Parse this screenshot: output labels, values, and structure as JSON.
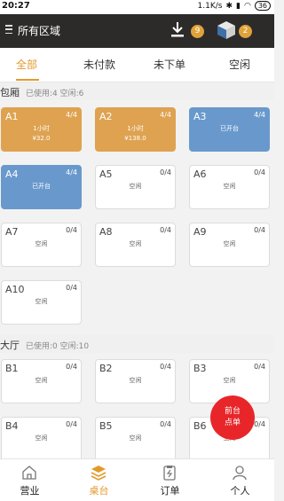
{
  "status_bar": {
    "time": "20:27",
    "speed": "1.1K/s",
    "battery": "36"
  },
  "header": {
    "title": "所有区域",
    "download_badge": "9",
    "box_badge": "2",
    "colors": {
      "background": "#2c2b2a",
      "badge": "#e0a33a"
    }
  },
  "tabs": [
    {
      "label": "全部",
      "active": true
    },
    {
      "label": "未付款",
      "active": false
    },
    {
      "label": "未下单",
      "active": false
    },
    {
      "label": "空闲",
      "active": false
    }
  ],
  "sections": [
    {
      "name": "包厢",
      "stats": "已使用:4 空闲:6",
      "tables": [
        {
          "name": "A1",
          "capacity": "4/4",
          "status": "1小时",
          "amount": "¥32.0",
          "color": "orange"
        },
        {
          "name": "A2",
          "capacity": "4/4",
          "status": "1小时",
          "amount": "¥138.0",
          "color": "orange"
        },
        {
          "name": "A3",
          "capacity": "4/4",
          "status": "已开台",
          "amount": "",
          "color": "blue"
        },
        {
          "name": "A4",
          "capacity": "4/4",
          "status": "已开台",
          "amount": "",
          "color": "blue"
        },
        {
          "name": "A5",
          "capacity": "0/4",
          "status": "空闲",
          "amount": "",
          "color": "white"
        },
        {
          "name": "A6",
          "capacity": "0/4",
          "status": "空闲",
          "amount": "",
          "color": "white"
        },
        {
          "name": "A7",
          "capacity": "0/4",
          "status": "空闲",
          "amount": "",
          "color": "white"
        },
        {
          "name": "A8",
          "capacity": "0/4",
          "status": "空闲",
          "amount": "",
          "color": "white"
        },
        {
          "name": "A9",
          "capacity": "0/4",
          "status": "空闲",
          "amount": "",
          "color": "white"
        },
        {
          "name": "A10",
          "capacity": "0/4",
          "status": "空闲",
          "amount": "",
          "color": "white"
        }
      ]
    },
    {
      "name": "大厅",
      "stats": "已使用:0 空闲:10",
      "tables": [
        {
          "name": "B1",
          "capacity": "0/4",
          "status": "空闲",
          "amount": "",
          "color": "white"
        },
        {
          "name": "B2",
          "capacity": "0/4",
          "status": "空闲",
          "amount": "",
          "color": "white"
        },
        {
          "name": "B3",
          "capacity": "0/4",
          "status": "空闲",
          "amount": "",
          "color": "white"
        },
        {
          "name": "B4",
          "capacity": "0/4",
          "status": "空闲",
          "amount": "",
          "color": "white"
        },
        {
          "name": "B5",
          "capacity": "0/4",
          "status": "空闲",
          "amount": "",
          "color": "white"
        },
        {
          "name": "B6",
          "capacity": "0/4",
          "status": "空闲",
          "amount": "",
          "color": "white"
        }
      ]
    }
  ],
  "fab": {
    "line1": "前台",
    "line2": "点单",
    "color": "#e8262a"
  },
  "bottom_nav": [
    {
      "label": "营业",
      "icon": "home-icon",
      "active": false
    },
    {
      "label": "桌台",
      "icon": "layers-icon",
      "active": true
    },
    {
      "label": "订单",
      "icon": "order-icon",
      "active": false
    },
    {
      "label": "个人",
      "icon": "person-icon",
      "active": false
    }
  ],
  "accent_color": "#e39a2c"
}
